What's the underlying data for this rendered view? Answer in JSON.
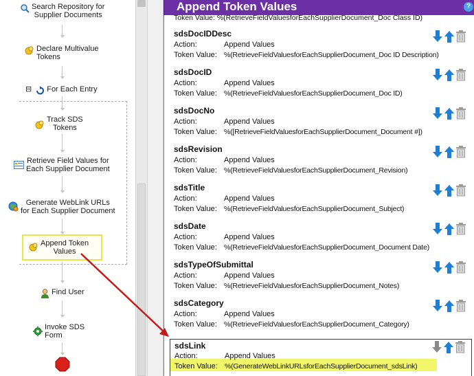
{
  "workflow": {
    "steps": [
      {
        "label_line1": "Search Repository for",
        "label_line2": "Supplier Documents",
        "icon": "search-icon"
      },
      {
        "label_line1": "Declare Multivalue",
        "label_line2": "Tokens",
        "icon": "token-icon"
      },
      {
        "label_line1": "For Each Entry",
        "label_line2": "",
        "icon": "loop-icon"
      },
      {
        "label_line1": "Track SDS",
        "label_line2": "Tokens",
        "icon": "token-icon"
      },
      {
        "label_line1": "Retrieve Field Values for",
        "label_line2": "Each Supplier Document",
        "icon": "field-values-icon"
      },
      {
        "label_line1": "Generate WebLink URLs",
        "label_line2": "for Each Supplier Document",
        "icon": "weblink-icon"
      },
      {
        "label_line1": "Append Token",
        "label_line2": "Values",
        "icon": "token-icon"
      },
      {
        "label_line1": "Find User",
        "label_line2": "",
        "icon": "user-icon"
      },
      {
        "label_line1": "Invoke SDS",
        "label_line2": "Form",
        "icon": "gear-icon"
      }
    ],
    "collapse_glyph": "⊟"
  },
  "panel": {
    "title": "Append Token Values",
    "help_glyph": "?",
    "partial_row_text": "Token Value: %(RetrieveFieldValuesforEachSupplierDocument_Doc Class ID)",
    "action_label": "Action:",
    "value_label": "Token Value:",
    "tokens": [
      {
        "name": "sdsDocIDDesc",
        "action": "Append Values",
        "value": "%(RetrieveFieldValuesforEachSupplierDocument_Doc ID Description)"
      },
      {
        "name": "sdsDocID",
        "action": "Append Values",
        "value": "%(RetrieveFieldValuesforEachSupplierDocument_Doc ID)"
      },
      {
        "name": "sdsDocNo",
        "action": "Append Values",
        "value": "%([RetrieveFieldValuesforEachSupplierDocument_Document #])"
      },
      {
        "name": "sdsRevision",
        "action": "Append Values",
        "value": "%(RetrieveFieldValuesforEachSupplierDocument_Revision)"
      },
      {
        "name": "sdsTitle",
        "action": "Append Values",
        "value": "%(RetrieveFieldValuesforEachSupplierDocument_Subject)"
      },
      {
        "name": "sdsDate",
        "action": "Append Values",
        "value": "%(RetrieveFieldValuesforEachSupplierDocument_Document Date)"
      },
      {
        "name": "sdsTypeOfSubmittal",
        "action": "Append Values",
        "value": "%(RetrieveFieldValuesforEachSupplierDocument_Notes)"
      },
      {
        "name": "sdsCategory",
        "action": "Append Values",
        "value": "%(RetrieveFieldValuesforEachSupplierDocument_Category)"
      },
      {
        "name": "sdsLink",
        "action": "Append Values",
        "value": "%(GenerateWebLinkURLsforEachSupplierDocument_sdsLink)"
      }
    ]
  },
  "colors": {
    "header_bg": "#6d2fa6",
    "arrow_blue": "#1f7fd6",
    "highlight_yellow": "#f1f56a",
    "annotation_red": "#c41a1a"
  }
}
